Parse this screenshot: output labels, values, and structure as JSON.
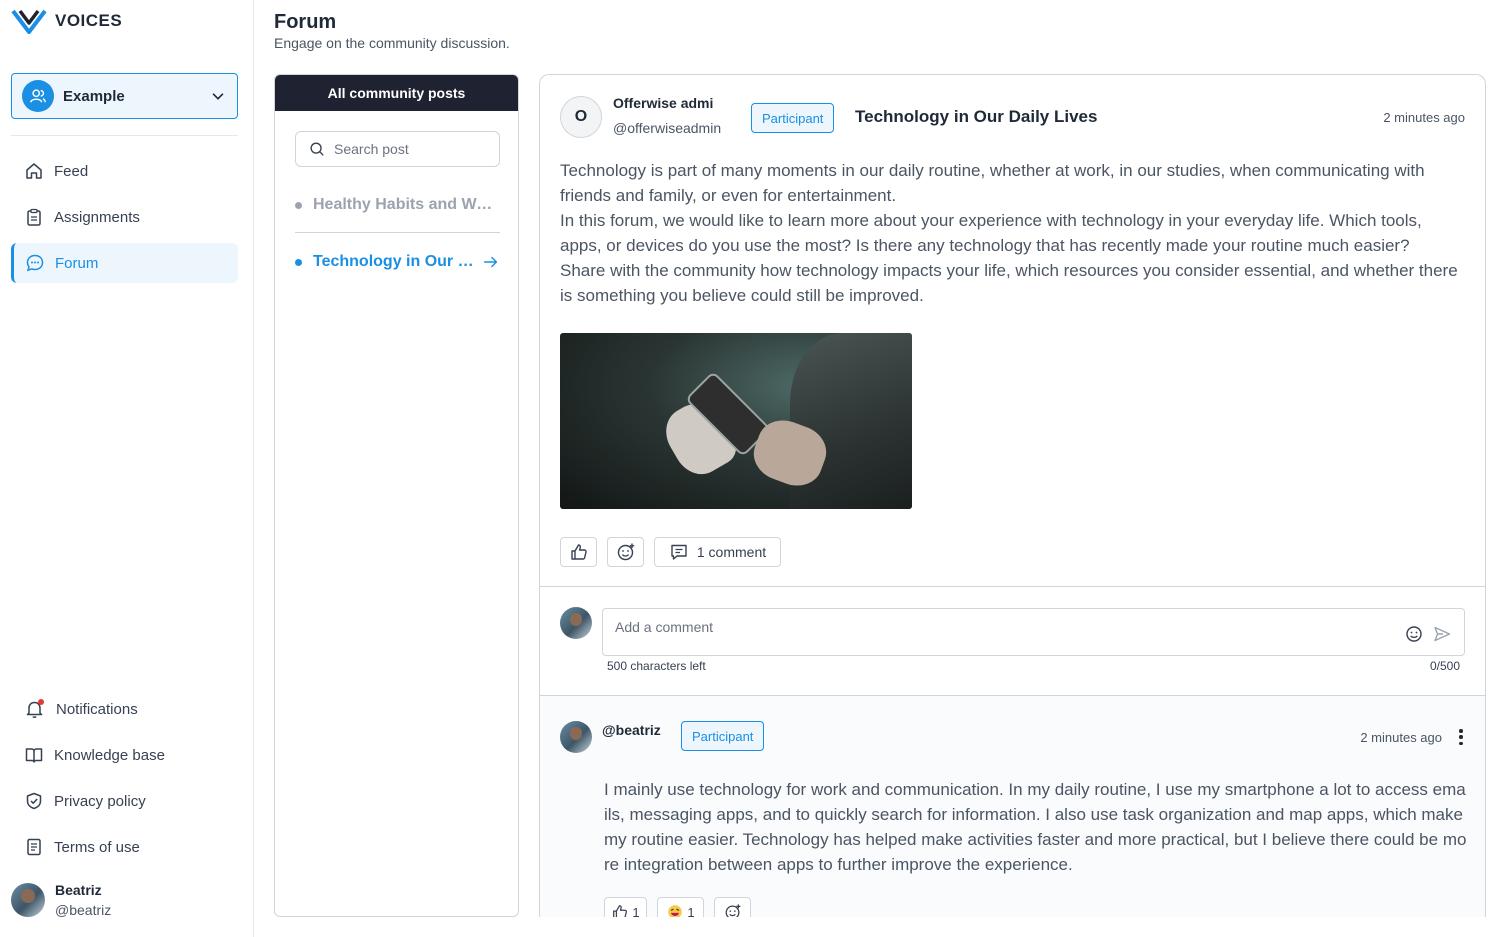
{
  "app": {
    "brand": "VOICES"
  },
  "workspace": {
    "name": "Example"
  },
  "nav": {
    "feed": "Feed",
    "assignments": "Assignments",
    "forum": "Forum",
    "notifications": "Notifications",
    "knowledge_base": "Knowledge base",
    "privacy_policy": "Privacy policy",
    "terms_of_use": "Terms of use"
  },
  "user": {
    "name": "Beatriz",
    "handle": "@beatriz"
  },
  "page": {
    "title": "Forum",
    "subtitle": "Engage on the community discussion."
  },
  "post_list": {
    "header": "All community posts",
    "search_placeholder": "Search post",
    "items": [
      {
        "label": "Healthy Habits and Wellbeing",
        "active": false
      },
      {
        "label": "Technology in Our Daily Lives",
        "active": true
      }
    ]
  },
  "post": {
    "author_initial": "O",
    "author_name": "Offerwise admi",
    "author_handle": "@offerwiseadmin",
    "role_badge": "Participant",
    "title": "Technology in Our Daily Lives",
    "time": "2 minutes ago",
    "body": [
      "Technology is part of many moments in our daily routine, whether at work, in our studies, when communicating with friends and family, or even for entertainment.",
      "In this forum, we would like to learn more about your experience with technology in your everyday life. Which tools, apps, or devices do you use the most? Is there any technology that has recently made your routine much easier?",
      "Share with the community how technology impacts your life, which resources you consider essential, and whether there is something you believe could still be improved."
    ],
    "comment_count_label": "1 comment"
  },
  "comment_input": {
    "placeholder": "Add a comment",
    "chars_left": "500 characters left",
    "counter": "0/500"
  },
  "comment": {
    "handle": "@beatriz",
    "role_badge": "Participant",
    "time": "2 minutes ago",
    "body": "I mainly use technology for work and communication. In my daily routine, I use my smartphone a lot to access emails, messaging apps, and to quickly search for information. I also use task organization and map apps, which make my routine easier. Technology has helped make activities faster and more practical, but I believe there could be more integration between apps to further improve the experience.",
    "likes": "1",
    "laugh_count": "1"
  },
  "colors": {
    "accent": "#1a8fe3",
    "accent_bg": "#eef6fd",
    "list_header_bg": "#1f2230",
    "muted_text": "#4b5563",
    "notification_dot": "#e53935",
    "inactive_post": "#9ca3af"
  }
}
